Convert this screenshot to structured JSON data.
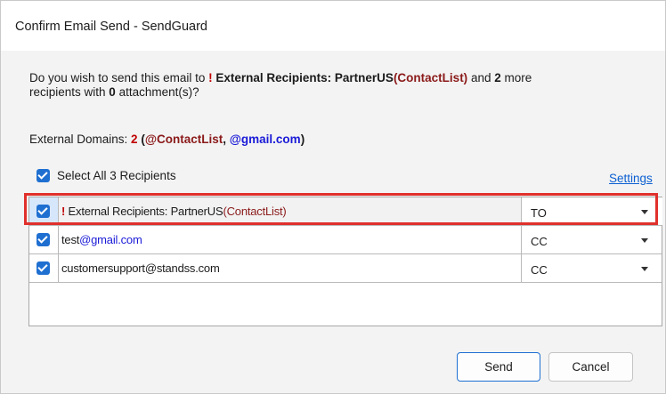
{
  "window": {
    "title": "Confirm Email Send - SendGuard"
  },
  "question": {
    "prefix": "Do you wish to send this email to ",
    "bang": "!",
    "ext_label": " External Recipients: PartnerUS",
    "ext_list": "(ContactList)",
    "middle": " and ",
    "more_count": "2",
    "more_text": " more",
    "line2_a": "recipients with ",
    "attach_count": "0",
    "line2_b": " attachment(s)?"
  },
  "domains": {
    "label": "External Domains: ",
    "count": "2",
    "open": " (",
    "domain1": "@ContactList",
    "sep": ", ",
    "domain2": "@gmail.com",
    "close": ")"
  },
  "select_all": {
    "label": "Select All 3 Recipients",
    "checked": true
  },
  "settings_link": "Settings",
  "recipients": [
    {
      "bang": "!",
      "name": " External Recipients: PartnerUS",
      "suffix": "(ContactList)",
      "type": "TO",
      "checked": true
    },
    {
      "name": "test",
      "suffix": "@gmail.com",
      "type": "CC",
      "checked": true
    },
    {
      "name": "customersupport@standss.com",
      "suffix": "",
      "type": "CC",
      "checked": true
    }
  ],
  "buttons": {
    "send": "Send",
    "cancel": "Cancel"
  },
  "colors": {
    "accent": "#1f6fd1",
    "warning_red": "#c00000",
    "contact_red": "#8b1a1a",
    "domain_blue": "#1a1ad8",
    "highlight": "#e0302c"
  }
}
